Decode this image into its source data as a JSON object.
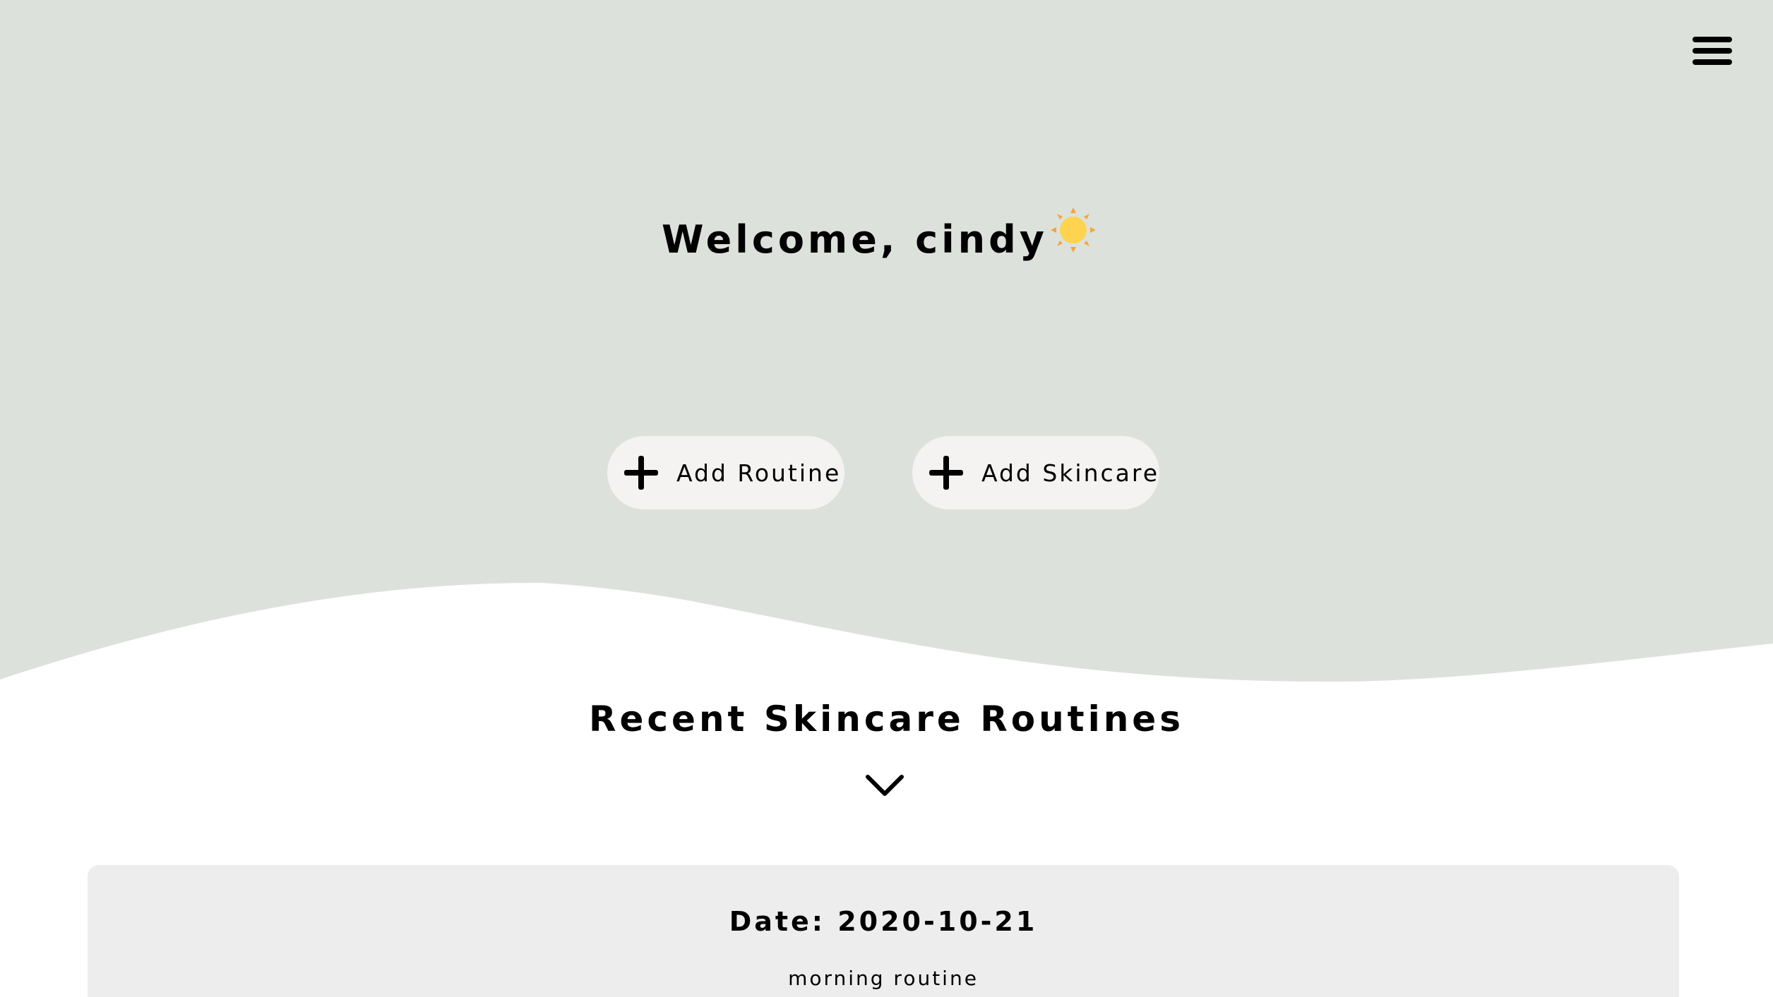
{
  "colors": {
    "hero_background": "#dde1db",
    "button_background": "#f4f3f1",
    "card_background": "#ededed",
    "sun_yellow": "#fdd34f",
    "sun_rays": "#f3a53d",
    "text": "#000000"
  },
  "header": {
    "menu_icon": "hamburger-menu-icon"
  },
  "welcome": {
    "text": "Welcome, cindy",
    "icon": "sun-icon"
  },
  "actions": {
    "add_routine_label": "Add Routine",
    "add_skincare_label": "Add Skincare",
    "icon": "plus-icon"
  },
  "recent": {
    "title": "Recent Skincare Routines",
    "toggle_icon": "chevron-down-icon"
  },
  "routines": [
    {
      "date": "Date: 2020-10-21",
      "name": "morning routine"
    }
  ]
}
